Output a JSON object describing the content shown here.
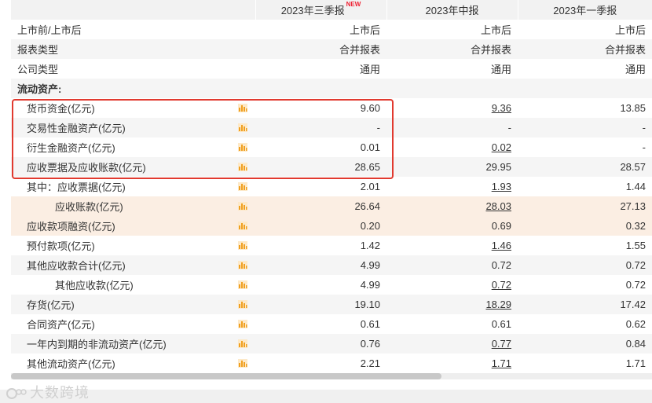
{
  "columns": {
    "label": "",
    "q3": "2023年三季报",
    "q3_badge": "NEW",
    "h1": "2023年中报",
    "q1": "2023年一季报"
  },
  "rows": [
    {
      "label": "上市前/上市后",
      "q3": "上市后",
      "h1": "上市后",
      "q1": "上市后"
    },
    {
      "label": "报表类型",
      "q3": "合并报表",
      "h1": "合并报表",
      "q1": "合并报表"
    },
    {
      "label": "公司类型",
      "q3": "通用",
      "h1": "通用",
      "q1": "通用"
    },
    {
      "label": "流动资产:",
      "q3": "",
      "h1": "",
      "q1": ""
    },
    {
      "label": "货币资金(亿元)",
      "q3": "9.60",
      "h1": "9.36",
      "q1": "13.85"
    },
    {
      "label": "交易性金融资产(亿元)",
      "q3": "-",
      "h1": "-",
      "q1": "-"
    },
    {
      "label": "衍生金融资产(亿元)",
      "q3": "0.01",
      "h1": "0.02",
      "q1": "-"
    },
    {
      "label": "应收票据及应收账款(亿元)",
      "q3": "28.65",
      "h1": "29.95",
      "q1": "28.57"
    },
    {
      "label": "其中：应收票据(亿元)",
      "q3": "2.01",
      "h1": "1.93",
      "q1": "1.44"
    },
    {
      "label": "应收账款(亿元)",
      "q3": "26.64",
      "h1": "28.03",
      "q1": "27.13"
    },
    {
      "label": "应收款项融资(亿元)",
      "q3": "0.20",
      "h1": "0.69",
      "q1": "0.32"
    },
    {
      "label": "预付款项(亿元)",
      "q3": "1.42",
      "h1": "1.46",
      "q1": "1.55"
    },
    {
      "label": "其他应收款合计(亿元)",
      "q3": "4.99",
      "h1": "0.72",
      "q1": "0.72"
    },
    {
      "label": "其他应收款(亿元)",
      "q3": "4.99",
      "h1": "0.72",
      "q1": "0.72"
    },
    {
      "label": "存货(亿元)",
      "q3": "19.10",
      "h1": "18.29",
      "q1": "17.42"
    },
    {
      "label": "合同资产(亿元)",
      "q3": "0.61",
      "h1": "0.61",
      "q1": "0.62"
    },
    {
      "label": "一年内到期的非流动资产(亿元)",
      "q3": "0.76",
      "h1": "0.77",
      "q1": "0.84"
    },
    {
      "label": "其他流动资产(亿元)",
      "q3": "2.21",
      "h1": "1.71",
      "q1": "1.71"
    }
  ],
  "watermark": "大数跨境",
  "icon_names": {
    "chart": "bar-chart-icon",
    "logo": "watermark-logo-icon"
  },
  "colors": {
    "highlight_box": "#e13a2f",
    "new_badge": "#e23",
    "chart_icon": "#f0a020",
    "row_highlight": "#fbeee3"
  }
}
